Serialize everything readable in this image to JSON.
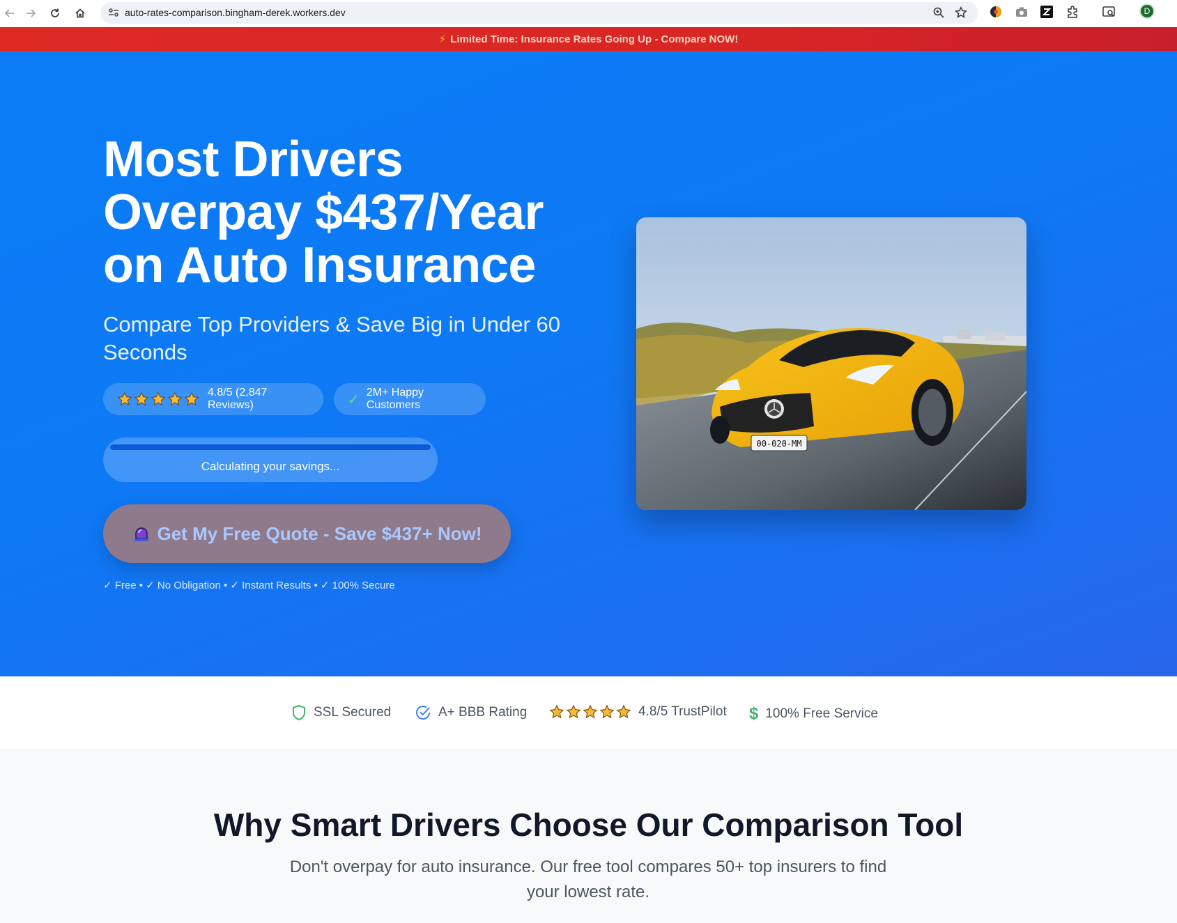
{
  "browser": {
    "url": "auto-rates-comparison.bingham-derek.workers.dev",
    "profile_initial": "D",
    "icons": [
      "back-icon",
      "forward-icon",
      "reload-icon",
      "home-icon",
      "site-settings-icon",
      "zoom-icon",
      "bookmark-star-icon"
    ]
  },
  "promo": {
    "text": "Limited Time: Insurance Rates Going Up - Compare NOW!",
    "icon": "lightning-icon"
  },
  "hero": {
    "title": "Most Drivers Overpay $437/Year on Auto Insurance",
    "subtitle": "Compare Top Providers & Save Big in Under 60 Seconds",
    "rating_text": "4.8/5 (2,847 Reviews)",
    "rating_stars": 5,
    "customers_text": "2M+ Happy Customers",
    "progress": {
      "label": "Calculating your savings...",
      "fraction": 1.0
    },
    "cta_label": "Get My Free Quote - Save $437+ Now!",
    "assurances": "✓ Free • ✓ No Obligation • ✓ Instant Results • ✓ 100% Secure",
    "image": "yellow-sports-car-photo"
  },
  "trust": {
    "items": [
      {
        "icon": "shield-icon",
        "label": "SSL Secured"
      },
      {
        "icon": "check-circle-icon",
        "label": "A+ BBB Rating"
      },
      {
        "icon": "five-stars-icon",
        "label": "4.8/5 TrustPilot"
      },
      {
        "icon": "dollar-icon",
        "label": "100% Free Service"
      }
    ]
  },
  "why": {
    "title": "Why Smart Drivers Choose Our Comparison Tool",
    "description": "Don't overpay for auto insurance. Our free tool compares 50+ top insurers to find your lowest rate."
  },
  "colors": {
    "hero_blue": "#0e79f5",
    "promo_red": "#df2a24",
    "cta_bg": "#8e7a8a",
    "cta_text": "#a9c8ff",
    "star_gold": "#f6b93b"
  }
}
